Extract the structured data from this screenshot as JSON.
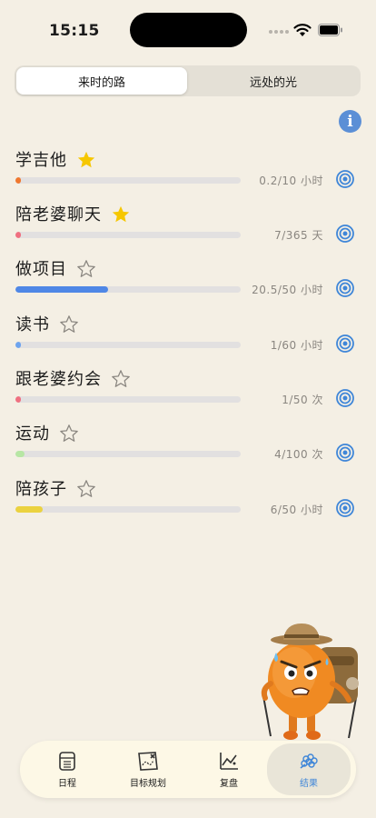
{
  "status_bar": {
    "time": "15:15"
  },
  "segmented": {
    "tabs": [
      "来时的路",
      "远处的光"
    ],
    "active": 0
  },
  "goals": [
    {
      "title": "学吉他",
      "starred": true,
      "progress_text": "0.2/10 小时",
      "current": 0.2,
      "target": 10,
      "color": "#f0772e"
    },
    {
      "title": "陪老婆聊天",
      "starred": true,
      "progress_text": "7/365 天",
      "current": 7,
      "target": 365,
      "color": "#f07080"
    },
    {
      "title": "做项目",
      "starred": false,
      "progress_text": "20.5/50 小时",
      "current": 20.5,
      "target": 50,
      "color": "#4f87e6"
    },
    {
      "title": "读书",
      "starred": false,
      "progress_text": "1/60 小时",
      "current": 1,
      "target": 60,
      "color": "#6ea4ee"
    },
    {
      "title": "跟老婆约会",
      "starred": false,
      "progress_text": "1/50 次",
      "current": 1,
      "target": 50,
      "color": "#f07080"
    },
    {
      "title": "运动",
      "starred": false,
      "progress_text": "4/100 次",
      "current": 4,
      "target": 100,
      "color": "#b7e6a4"
    },
    {
      "title": "陪孩子",
      "starred": false,
      "progress_text": "6/50 小时",
      "current": 6,
      "target": 50,
      "color": "#ebd23f"
    }
  ],
  "tab_bar": {
    "items": [
      {
        "label": "日程",
        "icon": "calendar-icon"
      },
      {
        "label": "目标规划",
        "icon": "map-icon"
      },
      {
        "label": "复盘",
        "icon": "chart-icon"
      },
      {
        "label": "结果",
        "icon": "harvest-icon"
      }
    ],
    "active": 3
  },
  "colors": {
    "background": "#f4efe4",
    "accent": "#3f86d8",
    "star": "#f6c700"
  }
}
